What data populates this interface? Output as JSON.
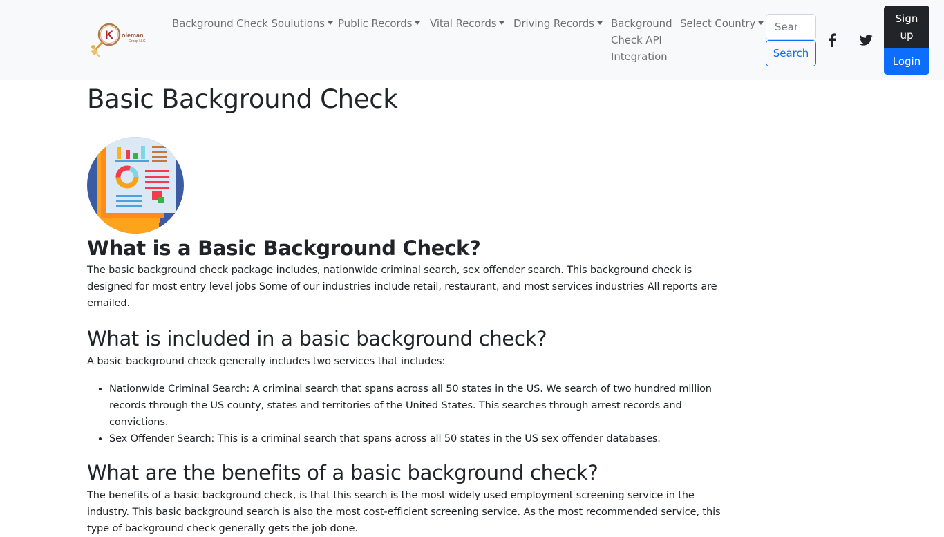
{
  "navbar": {
    "logo_alt": "Koleman Group LLC",
    "items": [
      {
        "label": "Background Check Soulutions",
        "dropdown": true
      },
      {
        "label": "Public Records",
        "dropdown": true
      },
      {
        "label": "Vital Records",
        "dropdown": true
      },
      {
        "label": "Driving Records",
        "dropdown": true
      },
      {
        "label": "Background Check API Integration",
        "dropdown": false
      },
      {
        "label": "Select Country",
        "dropdown": true
      }
    ],
    "search": {
      "placeholder": "Search",
      "value": "",
      "button_label": "Search"
    },
    "social": [
      {
        "icon": "facebook-icon"
      },
      {
        "icon": "twitter-icon"
      }
    ],
    "signup_label": "Sign up",
    "login_label": "Login"
  },
  "main": {
    "title": "Basic Background Check",
    "image_alt": "report-icon",
    "sections": [
      {
        "heading": "What is a Basic Background Check?",
        "paragraph": "The basic background check package includes, nationwide criminal search, sex offender search. This background check is designed for most entry level jobs Some of our industries include retail, restaurant, and most services industries All reports are emailed."
      },
      {
        "heading": "What is included in a basic background check?",
        "paragraph": "A basic background check generally includes two services that includes:",
        "list": [
          "Nationwide Criminal Search: A criminal search that spans across all 50 states in the US. We search of two hundred million records through the US county, states and territories of the United States. This searches through arrest records and convictions.",
          "Sex Offender Search: This is a criminal search that spans across all 50 states in the US sex offender databases."
        ]
      },
      {
        "heading": "What are the benefits of a basic background check?",
        "paragraph": "The benefits of a basic background check, is that this search is the most widely used employment screening service in the industry. This basic background search is also the most cost-efficient screening service. As the most recommended service, this type of background check generally gets the job done."
      }
    ]
  },
  "colors": {
    "navbar_bg": "#f8f9fa",
    "primary": "#0d6efd",
    "dark": "#212529",
    "nav_text": "#737475"
  }
}
